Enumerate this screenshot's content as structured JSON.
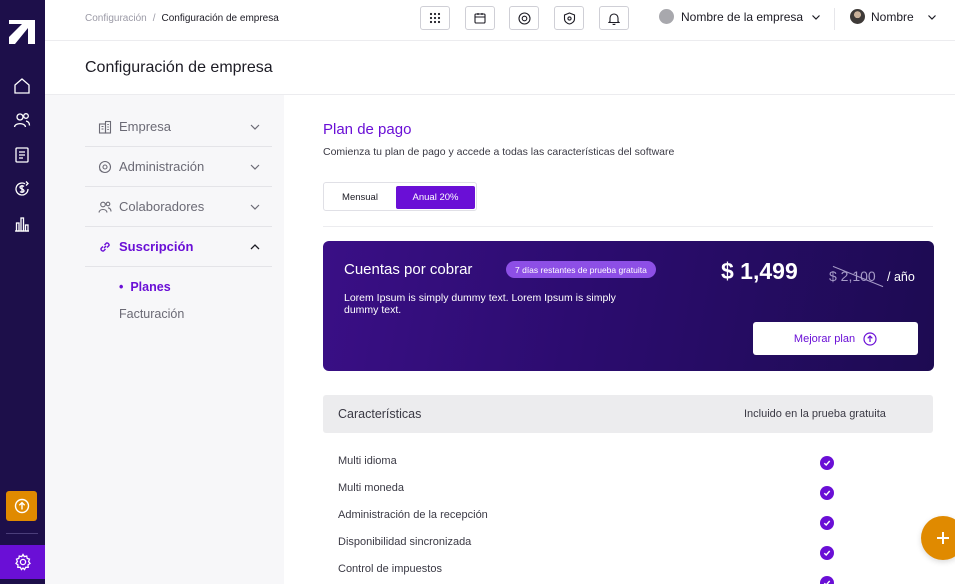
{
  "breadcrumb": {
    "parent": "Configuración",
    "separator": "/",
    "current": "Configuración de empresa"
  },
  "topbar": {
    "tools": [
      "apps-grid-icon",
      "calendar-icon",
      "radio-target-icon",
      "shield-gear-icon",
      "bell-icon"
    ],
    "company_name": "Nombre de la empresa",
    "user_name": "Nombre"
  },
  "page": {
    "title": "Configuración de empresa"
  },
  "settings_nav": {
    "items": [
      {
        "label": "Empresa",
        "icon": "building-icon",
        "expanded": false
      },
      {
        "label": "Administración",
        "icon": "admin-gear-icon",
        "expanded": false
      },
      {
        "label": "Colaboradores",
        "icon": "users-icon",
        "expanded": false
      },
      {
        "label": "Suscripción",
        "icon": "link-icon",
        "expanded": true
      }
    ],
    "sub_items": [
      {
        "label": "Planes",
        "bullet": "•",
        "active": true
      },
      {
        "label": "Facturación",
        "active": false
      }
    ]
  },
  "plan": {
    "title": "Plan de pago",
    "subtitle": "Comienza tu plan de pago y accede a todas las características del software",
    "toggle": {
      "monthly": "Mensual",
      "annual": "Anual  20%",
      "selected": "annual"
    },
    "card": {
      "name": "Cuentas por cobrar",
      "trial_badge": "7 días restantes de prueba gratuita",
      "description": "Lorem Ipsum is simply dummy text. Lorem Ipsum is simply dummy text.",
      "price": "$ 1,499",
      "old_price": "$ 2,100",
      "period": "/ año",
      "upgrade_label": "Mejorar plan"
    }
  },
  "features": {
    "header": "Características",
    "header_right": "Incluido en la prueba gratuita",
    "rows": [
      {
        "name": "Multi idioma",
        "included": true
      },
      {
        "name": "Multi moneda",
        "included": true
      },
      {
        "name": "Administración de la recepción",
        "included": true
      },
      {
        "name": "Disponibilidad sincronizada",
        "included": true
      },
      {
        "name": "Control de impuestos",
        "included": true
      }
    ]
  },
  "colors": {
    "accent": "#6a0fd6",
    "rail": "#1d0f4a",
    "orange": "#e08a00"
  }
}
